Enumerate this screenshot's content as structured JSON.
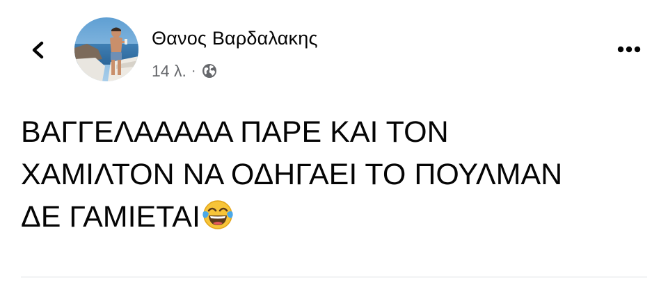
{
  "post": {
    "author": "Θανος Βαρδαλακης",
    "time": "14 λ.",
    "separator": "·",
    "privacy_icon": "globe-icon",
    "text_lines": [
      "ΒΑΓΓΕΛΑΑΑΑΑ ΠΑΡΕ ΚΑΙ ΤΟΝ",
      "ΧΑΜΙΛΤΟΝ ΝΑ ΟΔΗΓΑΕΙ ΤΟ ΠΟΥΛΜΑΝ",
      "ΔΕ ΓΑΜΙΕΤΑΙ"
    ],
    "trailing_emoji": "face-with-tears-of-joy"
  },
  "icons": {
    "back": "chevron-left-icon",
    "more": "more-horizontal-icon"
  },
  "colors": {
    "text_primary": "#050505",
    "text_secondary": "#65676b",
    "divider": "#dadde1"
  }
}
